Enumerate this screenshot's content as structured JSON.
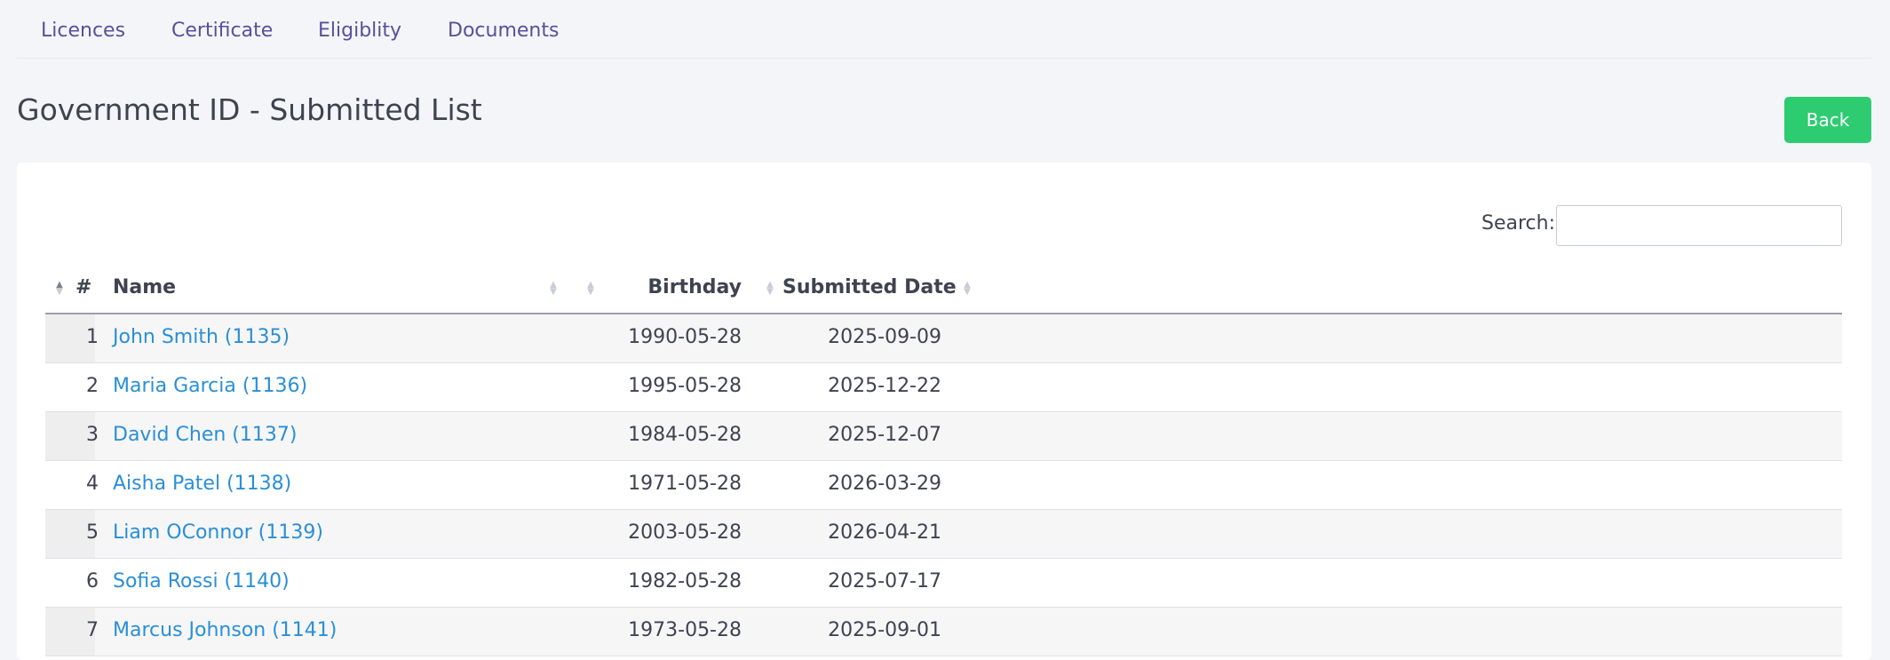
{
  "tabs": [
    "Licences",
    "Certificate",
    "Eligiblity",
    "Documents"
  ],
  "page_title": "Government ID - Submitted List",
  "back_label": "Back",
  "search": {
    "label": "Search:",
    "value": ""
  },
  "table": {
    "columns": [
      "#",
      "Name",
      "Birthday",
      "Submitted Date"
    ],
    "rows": [
      {
        "idx": "1",
        "name": "John Smith (1135)",
        "birthday": "1990-05-28",
        "submitted": "2025-09-09"
      },
      {
        "idx": "2",
        "name": "Maria Garcia (1136)",
        "birthday": "1995-05-28",
        "submitted": "2025-12-22"
      },
      {
        "idx": "3",
        "name": "David Chen (1137)",
        "birthday": "1984-05-28",
        "submitted": "2025-12-07"
      },
      {
        "idx": "4",
        "name": "Aisha Patel (1138)",
        "birthday": "1971-05-28",
        "submitted": "2026-03-29"
      },
      {
        "idx": "5",
        "name": "Liam OConnor (1139)",
        "birthday": "2003-05-28",
        "submitted": "2026-04-21"
      },
      {
        "idx": "6",
        "name": "Sofia Rossi (1140)",
        "birthday": "1982-05-28",
        "submitted": "2025-07-17"
      },
      {
        "idx": "7",
        "name": "Marcus Johnson (1141)",
        "birthday": "1973-05-28",
        "submitted": "2025-09-01"
      }
    ]
  }
}
